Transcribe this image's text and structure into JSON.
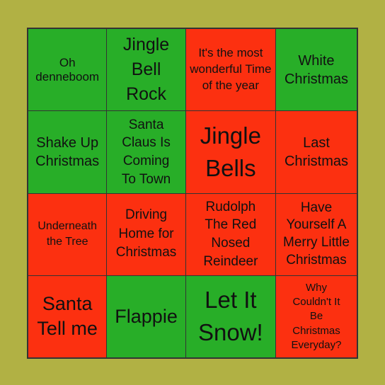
{
  "colors": {
    "background": "#b1b144",
    "green": "#28ae28",
    "red": "#fc3010",
    "grid": "#333333"
  },
  "cells": [
    {
      "text": "Oh denneboom",
      "color": "green"
    },
    {
      "text": "Jingle Bell Rock",
      "color": "green"
    },
    {
      "text": "It's the most wonderful Time of the year",
      "color": "red"
    },
    {
      "text": "White Christmas",
      "color": "green"
    },
    {
      "text": "Shake Up Christmas",
      "color": "green"
    },
    {
      "text": "Santa Claus Is Coming To Town",
      "color": "green"
    },
    {
      "text": "Jingle Bells",
      "color": "red"
    },
    {
      "text": "Last Christmas",
      "color": "red"
    },
    {
      "text": "Underneath the Tree",
      "color": "red"
    },
    {
      "text": "Driving Home for Christmas",
      "color": "red"
    },
    {
      "text": "Rudolph The Red Nosed Reindeer",
      "color": "red"
    },
    {
      "text": "Have Yourself A Merry Little Christmas",
      "color": "red"
    },
    {
      "text": "Santa Tell me",
      "color": "red"
    },
    {
      "text": "Flappie",
      "color": "green"
    },
    {
      "text": "Let It Snow!",
      "color": "green"
    },
    {
      "text": "Why Couldn't It Be Christmas Everyday?",
      "color": "red"
    }
  ]
}
